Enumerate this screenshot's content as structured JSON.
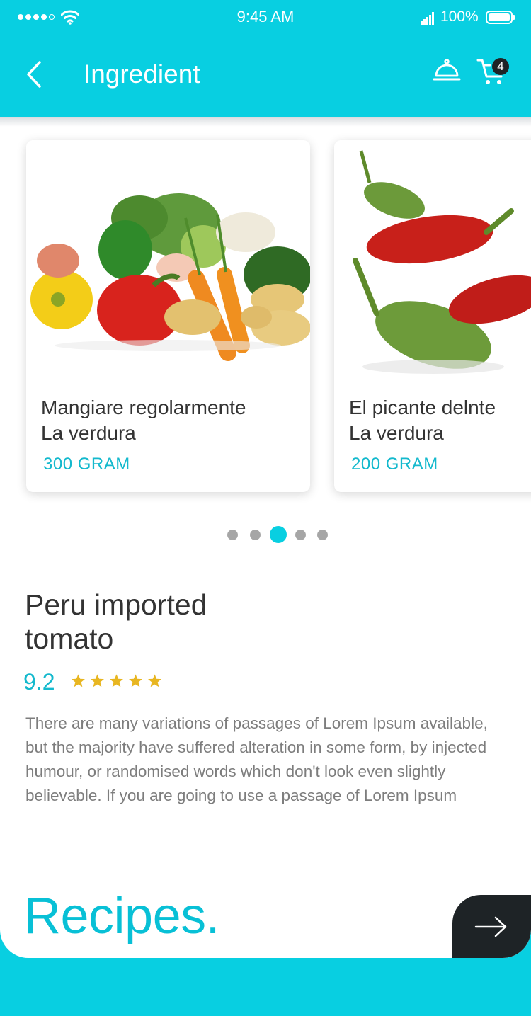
{
  "status_bar": {
    "time": "9:45 AM",
    "battery_pct": "100%"
  },
  "header": {
    "title": "Ingredient",
    "cart_count": "4",
    "back_icon": "chevron-left-icon",
    "bell_icon": "service-bell-icon",
    "cart_icon": "cart-icon",
    "color": "#08cfe1"
  },
  "carousel": {
    "cards": [
      {
        "name_line1": "Mangiare regolarmente",
        "name_line2": "La verdura",
        "weight": "300 GRAM"
      },
      {
        "name_line1": "El picante delnte",
        "name_line2": "La verdura",
        "weight": "200 GRAM"
      }
    ],
    "page_count": 5,
    "active_page": 3
  },
  "product": {
    "title_line1": "Peru imported",
    "title_line2": "tomato",
    "rating": "9.2",
    "stars": 5,
    "description": "There are many variations of passages of Lorem Ipsum available, but the majority have suffered alteration in some form, by injected humour, or randomised words which don't look even slightly believable. If you are going to use a passage of Lorem Ipsum"
  },
  "footer": {
    "recipes_label": "Recipes.",
    "next_icon": "arrow-right-icon"
  },
  "colors": {
    "accent": "#08cfe1",
    "accent_text": "#14b9cd",
    "star": "#e8b621",
    "dark": "#1e2326"
  }
}
